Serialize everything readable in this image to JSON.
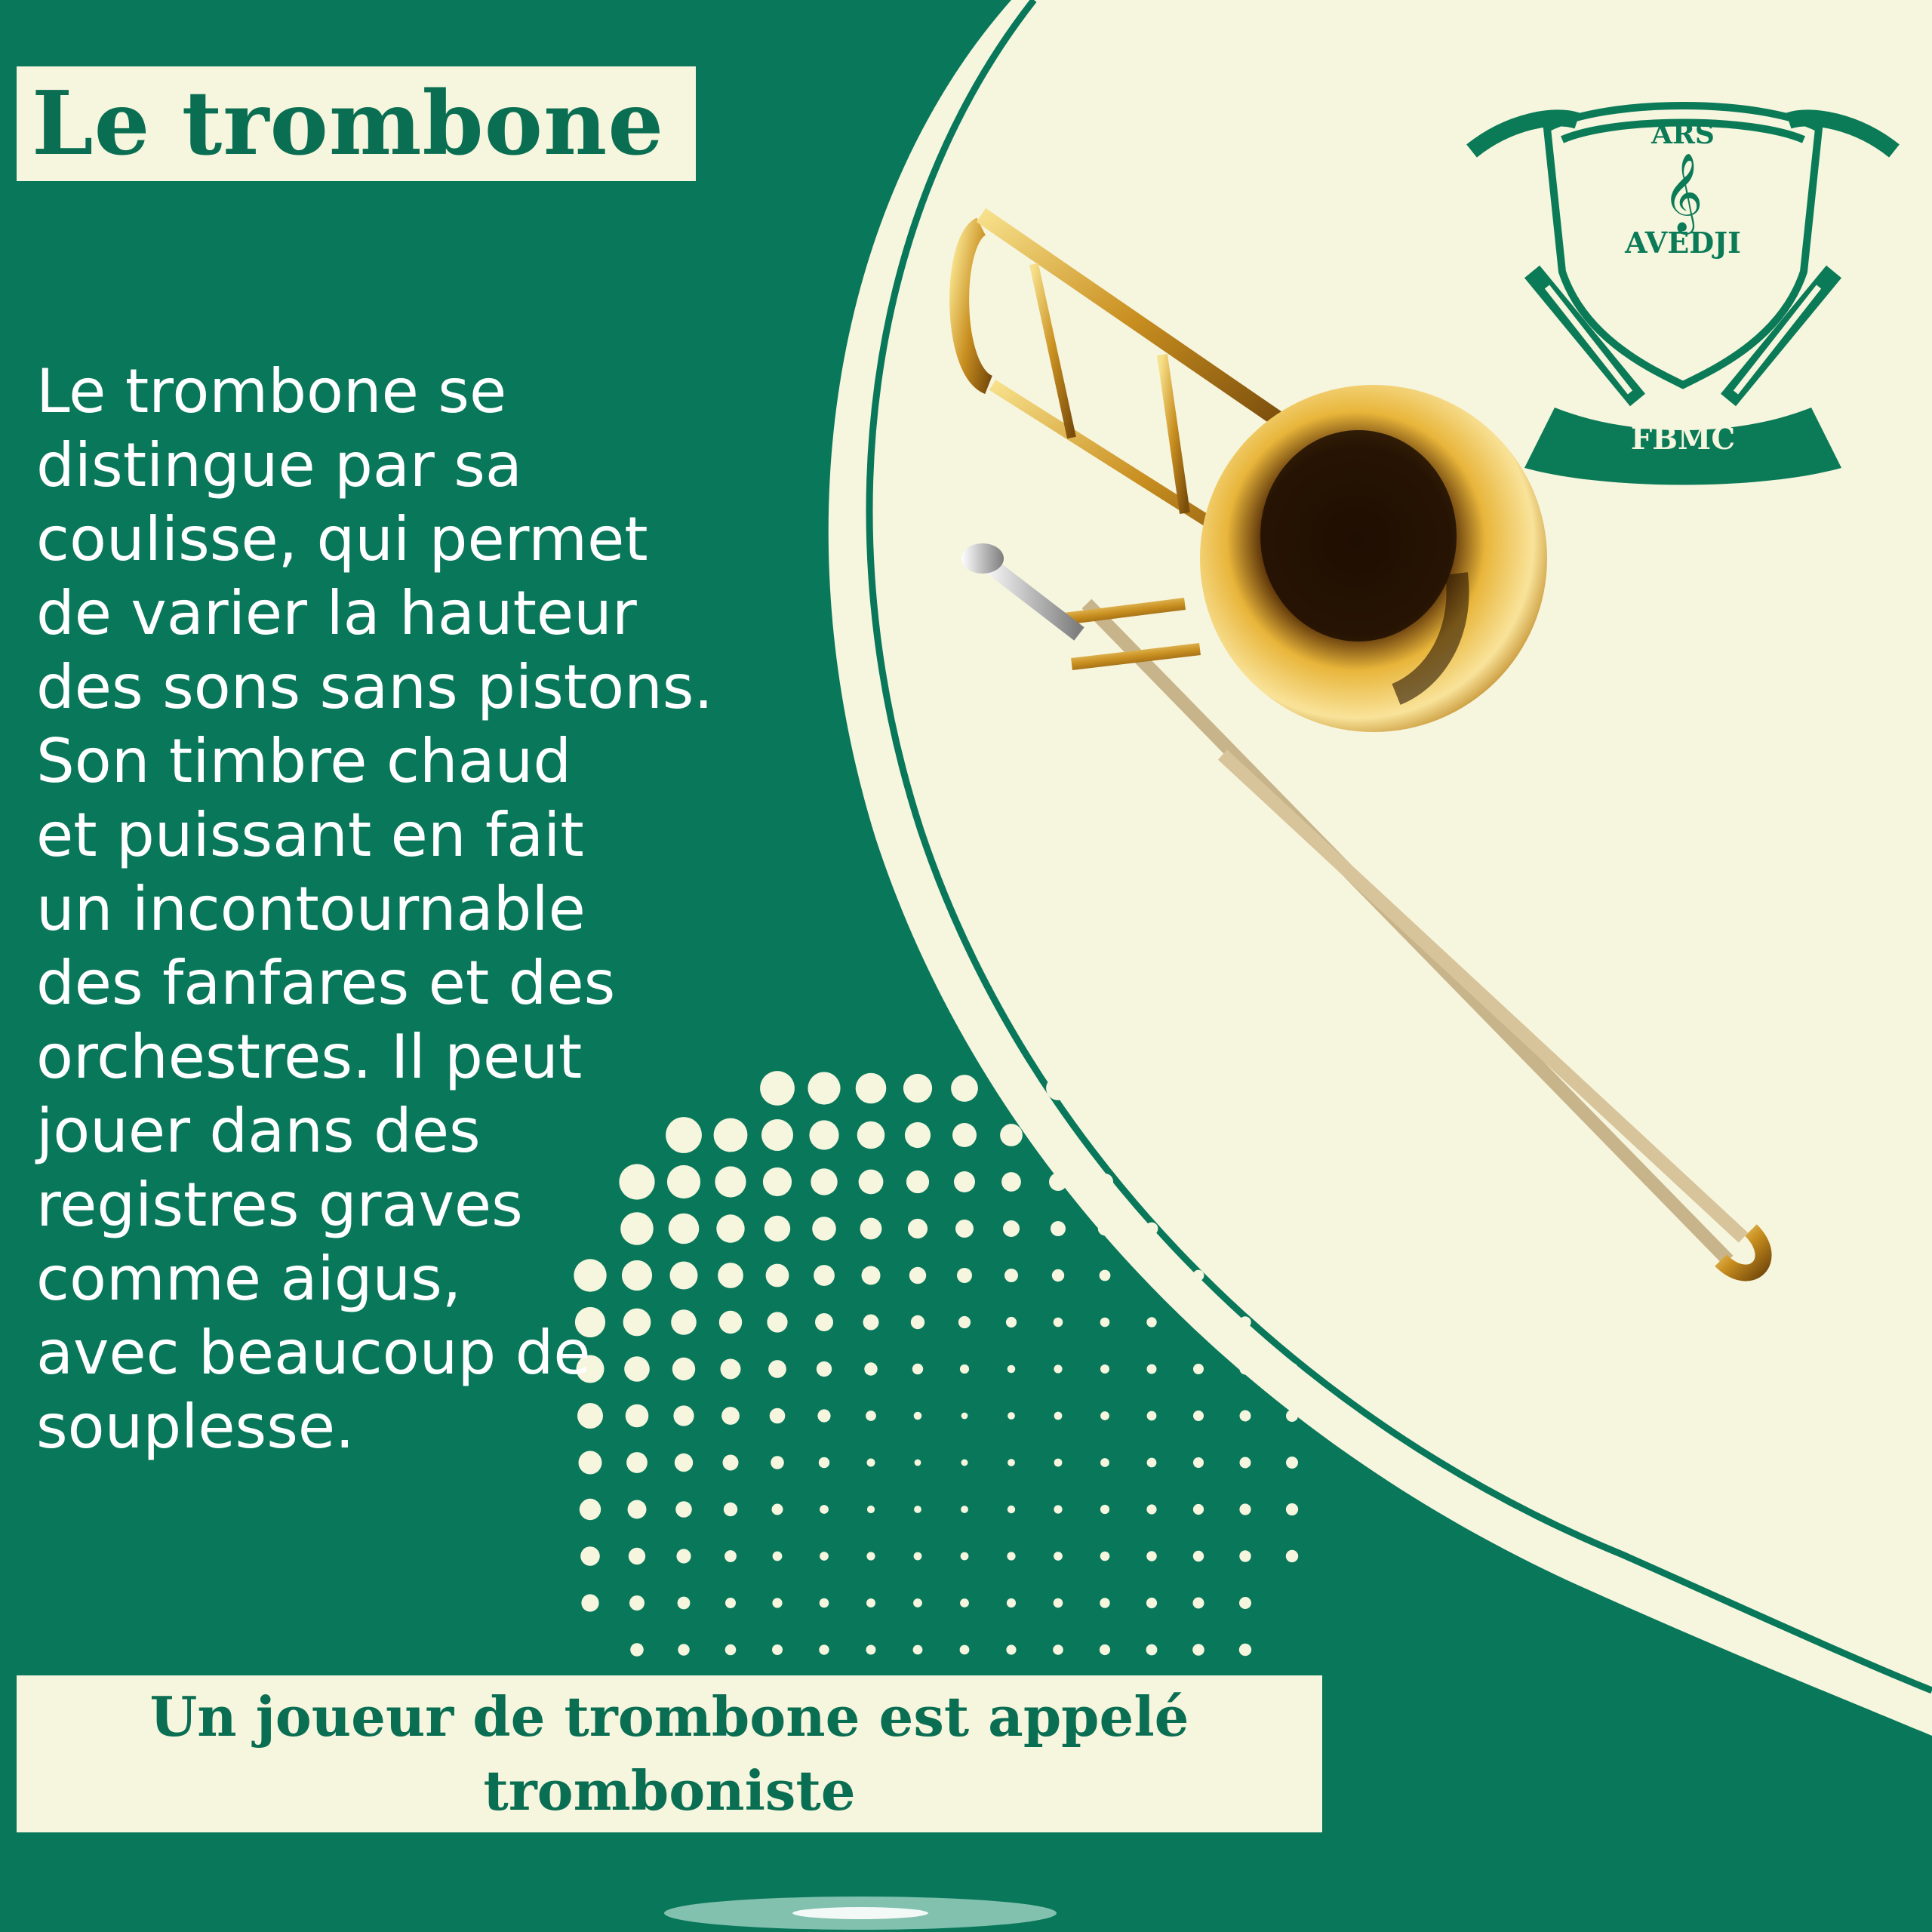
{
  "poster": {
    "title": "Le trombone",
    "body": "Le trombone se\ndistingue par sa\ncoulisse, qui permet\nde varier la hauteur\ndes sons sans pistons.\nSon timbre chaud\net puissant en fait\nun incontournable\ndes fanfares et des\norchestres. Il peut\njouer dans des\nregistres graves\ncomme aigus,\navec beaucoup de\nsouplesse.",
    "caption_line1": "Un joueur de trombone est appelé",
    "caption_line2": "tromboniste"
  },
  "logo": {
    "top_text": "ARS",
    "middle_text": "AVEDJI",
    "banner_text": "FBMC"
  },
  "images": {
    "instrument": "trombone-illustration",
    "emblem": "fanfare-crest-with-trumpets"
  },
  "colors": {
    "green": "#08775a",
    "cream": "#f6f5de",
    "text_on_green": "#ffffff",
    "brass": "#d9a83a"
  }
}
